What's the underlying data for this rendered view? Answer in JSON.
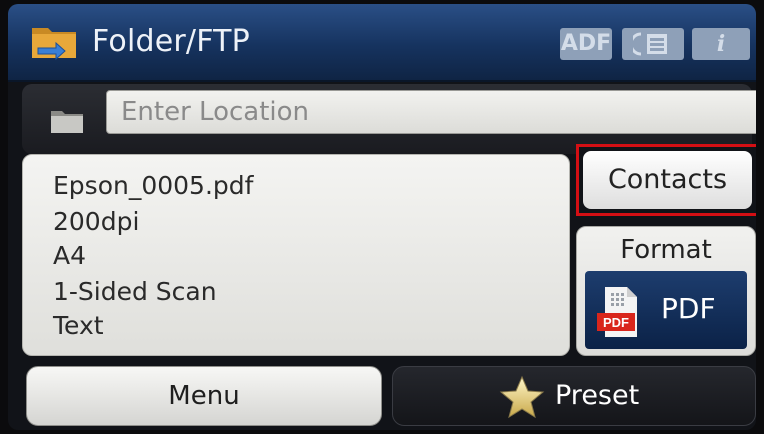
{
  "header": {
    "title": "Folder/FTP",
    "icon": "folder-ftp-icon",
    "buttons": {
      "adf": "ADF",
      "duplex_icon": "duplex-icon",
      "info": "i"
    },
    "colors": {
      "bar": "#16335f"
    }
  },
  "location": {
    "icon": "folder-icon",
    "placeholder": "Enter Location"
  },
  "summary": {
    "lines": [
      "Epson_0005.pdf",
      "200dpi",
      "A4",
      "1-Sided Scan",
      "Text"
    ]
  },
  "contacts": {
    "label": "Contacts",
    "highlight_color": "#d40f14"
  },
  "format": {
    "label": "Format",
    "value": "PDF",
    "icon": "pdf-icon"
  },
  "bottom": {
    "menu_label": "Menu",
    "preset_label": "Preset",
    "preset_icon": "star-icon"
  }
}
